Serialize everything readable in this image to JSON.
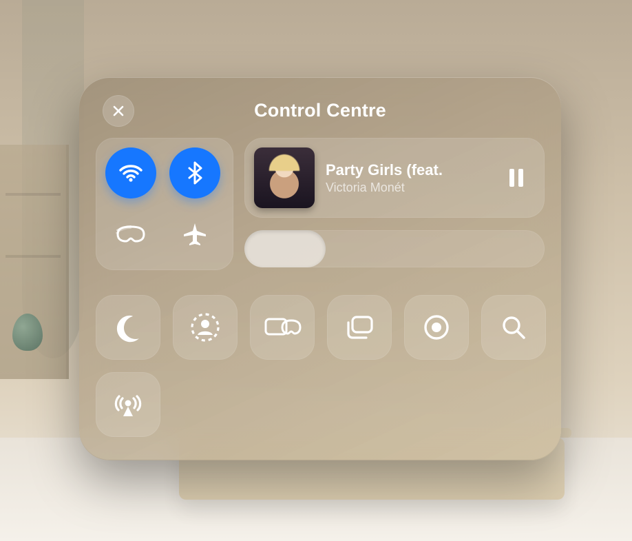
{
  "title": "Control Centre",
  "colors": {
    "accent": "#1677ff"
  },
  "connectivity": {
    "wifi": {
      "icon": "wifi-icon",
      "active": true
    },
    "bluetooth": {
      "icon": "bluetooth-icon",
      "active": true
    },
    "headset": {
      "icon": "headset-icon",
      "active": false
    },
    "airplane": {
      "icon": "airplane-icon",
      "active": false
    }
  },
  "media": {
    "title": "Party Girls (feat.",
    "artist": "Victoria Monét",
    "state": "playing",
    "control_icon": "pause-icon"
  },
  "volume": {
    "percent": 27
  },
  "controls_row": [
    {
      "id": "focus",
      "icon": "moon-icon"
    },
    {
      "id": "guest-user",
      "icon": "guest-user-icon"
    },
    {
      "id": "mirror-display",
      "icon": "mirror-display-icon"
    },
    {
      "id": "window-switcher",
      "icon": "windows-icon"
    },
    {
      "id": "screen-record",
      "icon": "record-icon"
    },
    {
      "id": "search",
      "icon": "search-icon"
    }
  ],
  "extra_row": [
    {
      "id": "airdrop",
      "icon": "airdrop-icon"
    }
  ]
}
